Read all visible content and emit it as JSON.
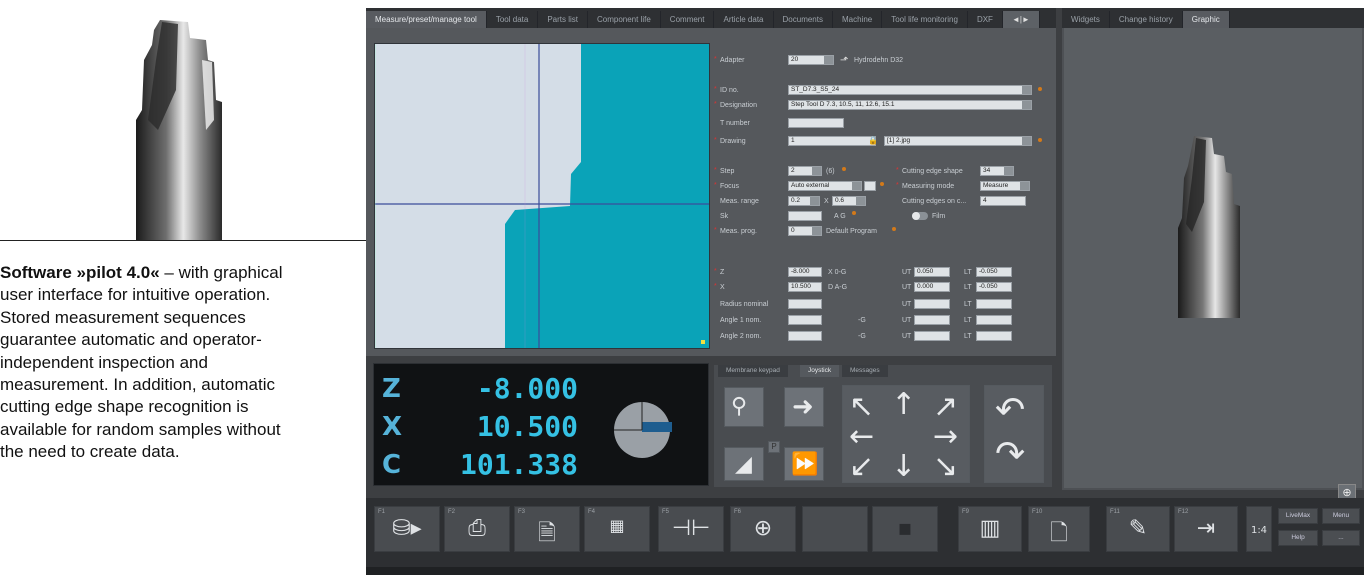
{
  "caption": {
    "title": "Software »pilot 4.0«",
    "text": " – with graphical user interface for intuitive operation. Stored measurement sequences guarantee automatic and operator-independent inspec­tion and measurement. In addi­tion, automatic cutting edge shape recognition is available for random samples without the need to create data."
  },
  "app": {
    "left_tabs": [
      "Measure/preset/manage tool",
      "Tool data",
      "Parts list",
      "Component life",
      "Comment",
      "Article data",
      "Documents",
      "Machine",
      "Tool life monitoring",
      "DXF",
      "◄|►"
    ],
    "right_tabs": [
      "Widgets",
      "Change history",
      "Graphic"
    ],
    "form": {
      "adapter_label": "Adapter",
      "adapter_value": "20",
      "adapter_desc": "Hydrodehn D32",
      "id_label": "ID no.",
      "id_value": "ST_D7.3_S5_24",
      "designation_label": "Designation",
      "designation_value": "Step Tool D 7.3, 10.5, 11, 12.6, 15.1",
      "tnumber_label": "T number",
      "drawing_label": "Drawing",
      "drawing_value": "1",
      "drawing_file": "[1] 2.jpg",
      "step_label": "Step",
      "step_value": "2",
      "step_unit": "(6)",
      "focus_label": "Focus",
      "focus_value": "Auto external",
      "meas_range_label": "Meas. range",
      "meas_range_a": "0.2",
      "meas_range_x": "X",
      "meas_range_b": "0.6",
      "sk_label": "Sk",
      "ag_label": "A G",
      "meas_prog_label": "Meas. prog.",
      "meas_prog_value": "0",
      "meas_prog_desc": "Default Program",
      "ces_label": "Cutting edge shape",
      "ces_value": "34",
      "mmode_label": "Measuring mode",
      "mmode_value": "Measure",
      "cedges_label": "Cutting edges on c...",
      "cedges_value": "4",
      "film_label": "Film",
      "z_label": "Z",
      "z_value": "-8.000",
      "z_tag": "X 0-G",
      "x_label": "X",
      "x_value": "10.500",
      "x_tag": "D A-G",
      "ut_label": "UT",
      "lt_label": "LT",
      "z_ut": "0.050",
      "z_lt": "-0.050",
      "x_ut": "0.000",
      "x_lt": "-0.050",
      "radius_label": "Radius nominal",
      "angle1_label": "Angle 1 nom.",
      "angle2_label": "Angle 2 nom.",
      "g_label": "-G"
    },
    "dro": {
      "z_axis": "Z",
      "z_value": "-8.000",
      "x_axis": "X",
      "x_value": "10.500",
      "c_axis": "C",
      "c_value": "101.338"
    },
    "joy_tabs": [
      "Membrane keypad",
      "Joystick",
      "Messages"
    ],
    "joy_p": "P",
    "fkeys": [
      "F1",
      "F2",
      "F3",
      "F4",
      "F5",
      "F6",
      "F9",
      "F10",
      "F11",
      "F12"
    ],
    "side_buttons": [
      "LiveMax",
      "Menu",
      "Help",
      "...",
      "1:4"
    ],
    "colors": {
      "accent": "#0aa3b8",
      "dro_text": "#35c1e4",
      "callout_dot": "#f4d80a"
    }
  }
}
